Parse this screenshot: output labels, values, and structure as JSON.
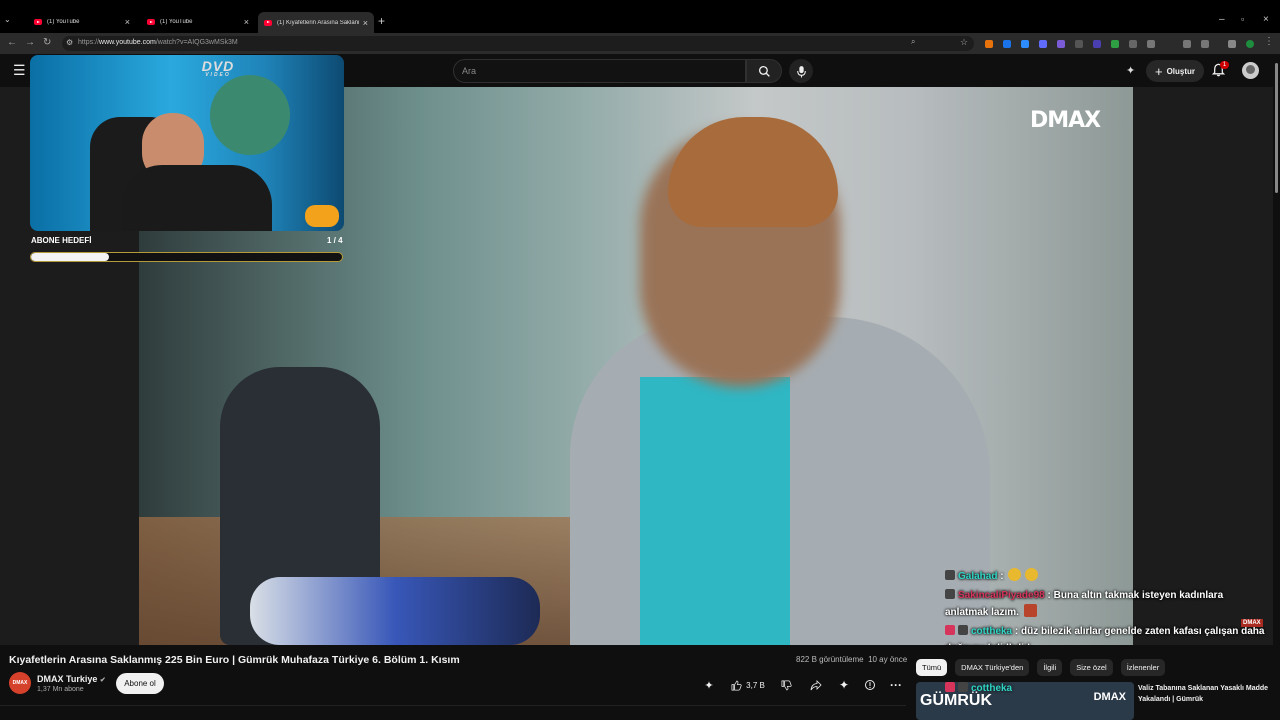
{
  "browser": {
    "tabs": [
      {
        "title": "(1) YouTube"
      },
      {
        "title": "(1) YouTube"
      },
      {
        "title": "(1) Kıyafetlerin Arasına Saklanmı"
      }
    ],
    "url_prefix": "https://",
    "url_host": "www.youtube.com",
    "url_path": "/watch?v=AIQG3wMSk3M"
  },
  "header": {
    "search_placeholder": "Ara",
    "create_label": "Oluştur",
    "notification_count": "1"
  },
  "overlay": {
    "dvd_logo": "DVD",
    "dvd_sub": "VIDEO",
    "goal_label": "ABONE HEDEFİ",
    "goal_count": "1 / 4",
    "goal_progress": 0.25,
    "watermark": "DMAX",
    "chat": [
      {
        "user": "Galahad",
        "text": " :",
        "user_color": "#2fd6c6"
      },
      {
        "user": "SakincaliPiyade98",
        "text": ": Buna altın takmak isteyen kadınlara anlatmak lazım.",
        "user_color": "#d6345a"
      },
      {
        "user": "cottheka",
        "text": ": düz bilezik alırlar genelde zaten kafası çalışan daha doğrusu hdjdhdjd",
        "user_color": "#2fd6c6"
      },
      {
        "user": "cottheka",
        "text": "",
        "user_color": "#2fd6c6"
      },
      {
        "user": "cottheka",
        "text": "",
        "user_color": "#2fd6c6"
      }
    ]
  },
  "video": {
    "title": "Kıyafetlerin Arasına Saklanmış 225 Bin Euro | Gümrük Muhafaza Türkiye 6. Bölüm 1. Kısım",
    "views": "822 B görüntüleme",
    "age": "10 ay önce",
    "channel_name": "DMAX Turkiye",
    "channel_avatar_text": "DMAX",
    "subscribers": "1,37 Mn abone",
    "subscribe_label": "Abone ol",
    "like_count": "3,7 B"
  },
  "sidebar": {
    "chips": [
      "Tümü",
      "DMAX Türkiye'den",
      "İlgili",
      "Size özel",
      "İzlenenler"
    ],
    "recommended": {
      "title": "Valiz Tabanına Saklanan Yasaklı Madde Yakalandı | Gümrük",
      "thumb_text": "GÜMRÜK",
      "thumb_logo": "DMAX"
    }
  },
  "colors": {
    "accent": "#ff0033",
    "background": "#0f0f0f",
    "goal_border": "#b49a3a"
  }
}
